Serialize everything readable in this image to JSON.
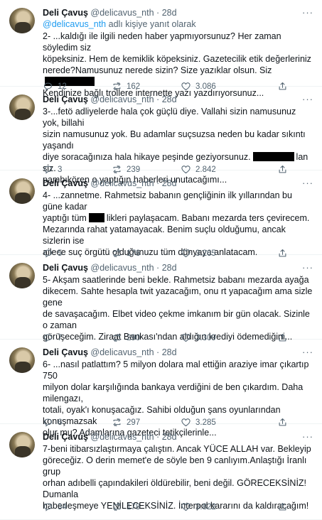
{
  "tweets": [
    {
      "name": "Deli Çavuş",
      "handle": "@delicavus_nth",
      "time": "28d",
      "reply_handle": "@delicavus_nth",
      "reply_suffix": "adlı kişiye yanıt olarak",
      "lines": [
        "2- ...kaldığı ile ilgili neden haber yapmıyorsunuz? Her zaman söyledim siz",
        "köpeksiniz. Hem de kemiklik köpeksiniz. Gazetecilik etik değerleriniz",
        "nerede?Namusunuz nerede sizin? Size yazıklar olsun. Siz",
        "Kendinize bağlı trollere internette yazı yazdırıyorsunuz..."
      ],
      "replies": "12",
      "retweets": "162",
      "likes": "3.086"
    },
    {
      "name": "Deli Çavuş",
      "handle": "@delicavus_nth",
      "time": "28d",
      "lines": [
        "3-...fetö adliyelerde hala çok güçlü diye. Vallahi sizin namusunuz yok, billahi",
        "sizin namusunuz yok. Bu adamlar suçsuzsa neden bu kadar sıkıntı yaşandı",
        "diye soracağınıza hala hikaye peşinde geziyorsunuz.",
        "pambıkören o yaptığın haberleri unutacağımı..."
      ],
      "line3_suffix": "lan siz.",
      "replies": "3",
      "retweets": "239",
      "likes": "2.842"
    },
    {
      "name": "Deli Çavuş",
      "handle": "@delicavus_nth",
      "time": "28d",
      "lines": [
        "4- ...zannetme. Rahmetsiz babanın gençliğinin ilk yıllarından bu güne kadar",
        "yaptığı tüm",
        "Mezarında rahat yatamayacak. Benim suçlu olduğumu, ancak sizlerin ise",
        "ailece suç örgütü olduğunuzu tüm dünyaya anlatacam."
      ],
      "line2_suffix": "likleri paylaşacam. Babanı mezarda ters çevirecem.",
      "replies": "5",
      "retweets": "176",
      "likes": "3.265"
    },
    {
      "name": "Deli Çavuş",
      "handle": "@delicavus_nth",
      "time": "28d",
      "lines": [
        "5- Akşam saatlerinde beni bekle. Rahmetsiz babanı mezarda ayağa",
        "dikecem. Sahte hesapla twit yazacağım, onu rt yapacağım ama sizle gene",
        "de savaşacağım. Elbet video çekme imkanım bir gün olacak. Sizinle o zaman",
        "görüşeceğim. Ziraat Bankası'ndan aldığın krediyi ödemediğini..."
      ],
      "replies": "7",
      "retweets": "290",
      "likes": "3.309"
    },
    {
      "name": "Deli Çavuş",
      "handle": "@delicavus_nth",
      "time": "28d",
      "lines": [
        "6- ...nasıl patlattım? 5 milyon dolara mal ettiğin araziye imar çıkartıp 750",
        "milyon dolar karşılığında bankaya verdiğini de ben çıkardım. Daha milengazı,",
        "totali, oyak'ı konuşacağız. Sahibi olduğun şans oyunlarından konuşmazsak",
        "olur mu? Adamlarına gazeteci tetikçilerinle..."
      ],
      "replies": "6",
      "retweets": "297",
      "likes": "3.285"
    },
    {
      "name": "Deli Çavuş",
      "handle": "@delicavus_nth",
      "time": "28d",
      "lines": [
        "7-beni itibarsızlaştırmaya çalıştın. Ancak YÜCE ALLAH var. Bekleyip",
        "göreceğiz. O derin memet'e de söyle ben 9 canlıyım.Anlaştığı İranlı grup",
        "orhan adıbelli çapındakileri öldürebilir, beni değil. GÖRECEKSİNİZ! Dumanla",
        "haberleşmeye YENİLECEKSİNİZ. İnterpol kararını da kaldıracağım!"
      ],
      "replies": "34",
      "retweets": "178",
      "likes": "3.822"
    }
  ],
  "more_glyph": "···",
  "colors": {
    "muted": "#536471",
    "link": "#1d9bf0",
    "text": "#0f1419",
    "divider": "#eff3f4"
  },
  "icons": [
    "reply-icon",
    "retweet-icon",
    "like-icon",
    "share-icon",
    "more-icon"
  ]
}
